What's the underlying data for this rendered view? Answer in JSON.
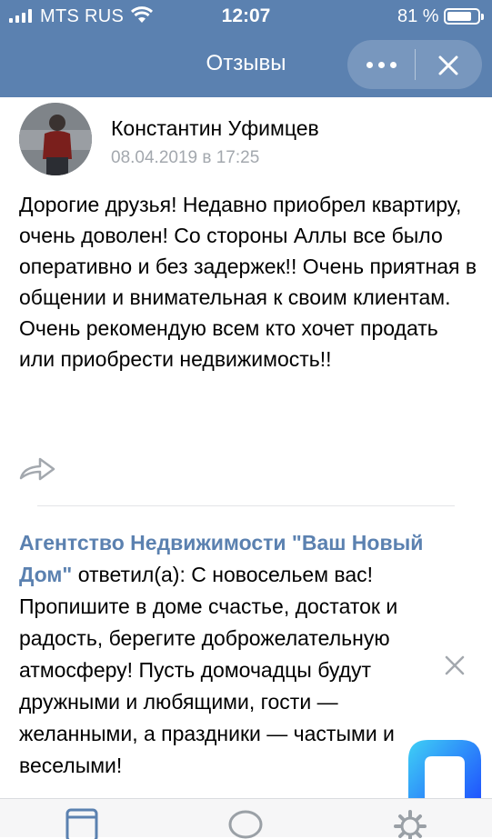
{
  "status": {
    "carrier": "MTS RUS",
    "time": "12:07",
    "battery_percent": "81 %",
    "battery_level": 0.81
  },
  "header": {
    "title": "Отзывы",
    "more_icon": "more-dots-icon",
    "close_icon": "close-icon"
  },
  "post": {
    "author": "Константин Уфимцев",
    "date": "08.04.2019 в 17:25",
    "text": "Дорогие друзья! Недавно приобрел квартиру, очень доволен! Со стороны Аллы все было оперативно и без задержек!! Очень приятная в общении и внимательная к своим клиентам. Очень рекомендую всем кто хочет продать или приобрести недвижимость!!",
    "share_icon": "share-icon"
  },
  "reply": {
    "author": "Агентство Недвижимости \"Ваш Новый Дом\"",
    "verb": " ответил(а): ",
    "text": "С новосельем вас! Пропишите в доме счастье, достаток и радость, берегите доброжелательную атмосферу! Пусть домочадцы будут дружными и любящими, гости — желанными, а праздники — частыми и веселыми!",
    "delete_icon": "close-icon"
  },
  "tabbar": {
    "items": [
      "window-icon",
      "comment-bubble-icon",
      "gear-icon"
    ]
  },
  "colors": {
    "header": "#5b81b0",
    "link": "#5b81b0",
    "date": "#a3a8ae"
  }
}
